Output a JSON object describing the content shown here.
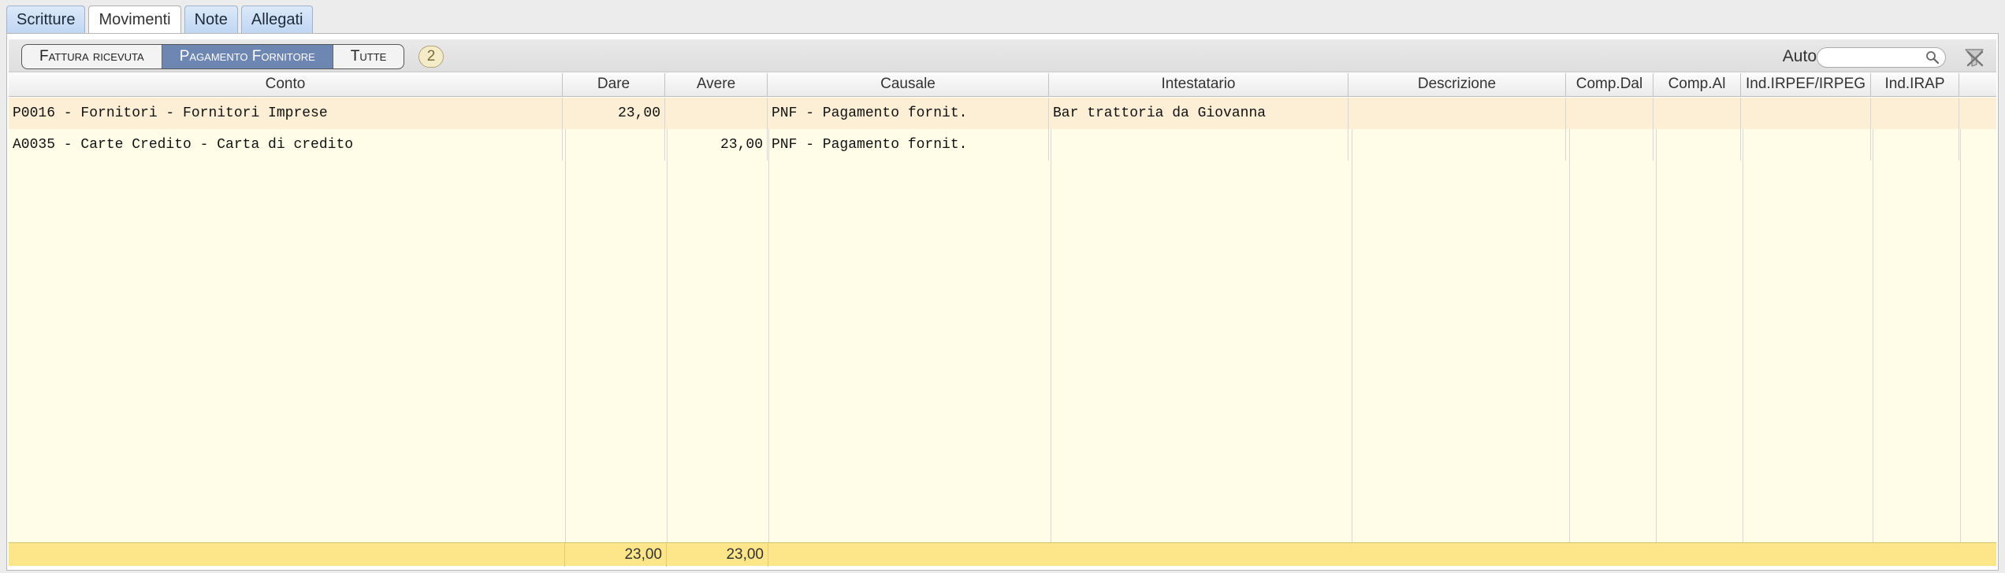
{
  "tabs": [
    {
      "label": "Scritture",
      "active": false
    },
    {
      "label": "Movimenti",
      "active": true
    },
    {
      "label": "Note",
      "active": false
    },
    {
      "label": "Allegati",
      "active": false
    }
  ],
  "toolbar": {
    "filters": [
      {
        "label": "Fattura ricevuta",
        "active": false
      },
      {
        "label": "Pagamento Fornitore",
        "active": true
      },
      {
        "label": "Tutte",
        "active": false
      }
    ],
    "count": "2",
    "auto_label": "Auto",
    "search_value": "",
    "search_placeholder": ""
  },
  "grid": {
    "columns": [
      "Conto",
      "Dare",
      "Avere",
      "Causale",
      "Intestatario",
      "Descrizione",
      "Comp.Dal",
      "Comp.Al",
      "Ind.IRPEF/IRPEG",
      "Ind.IRAP"
    ],
    "rows": [
      [
        "P0016 - Fornitori - Fornitori Imprese",
        "23,00",
        "",
        "PNF - Pagamento fornit.",
        "Bar trattoria da Giovanna",
        "",
        "",
        "",
        "",
        ""
      ],
      [
        "A0035 - Carte Credito - Carta di credito",
        "",
        "23,00",
        "PNF - Pagamento fornit.",
        "",
        "",
        "",
        "",
        "",
        ""
      ]
    ],
    "totals": {
      "dare": "23,00",
      "avere": "23,00"
    }
  },
  "colors": {
    "selected_row": "#fdefd6",
    "grid_background": "#fffde8",
    "totals_background": "#fde68a",
    "active_filter": "#6d86b2"
  }
}
